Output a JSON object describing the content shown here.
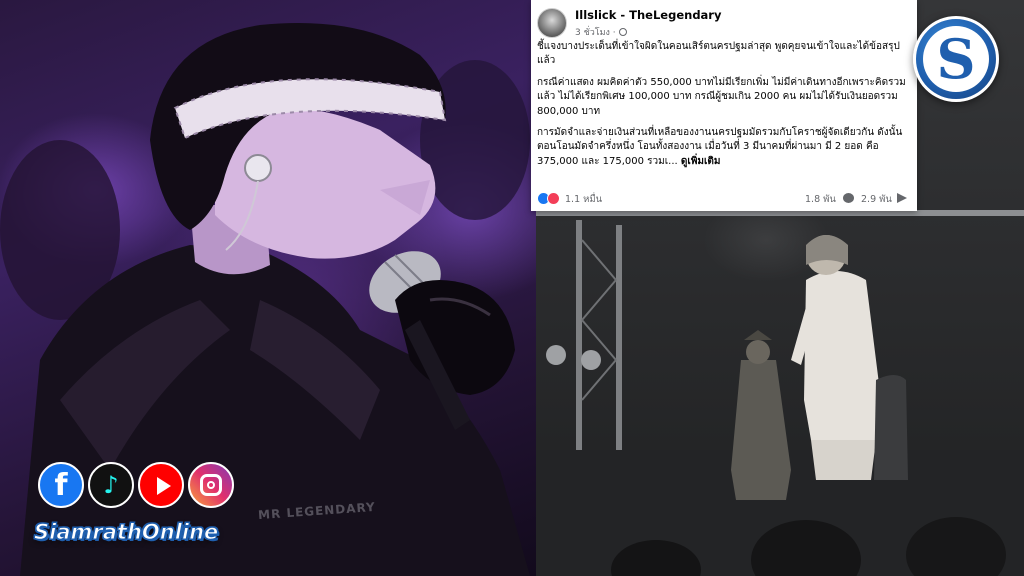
{
  "post": {
    "author": "Illslick - TheLegendary",
    "time": "3 ชั่วโมง ·",
    "paragraph_1": "ชี้แจงบางประเด็นที่เข้าใจผิดในคอนเสิร์ตนครปฐมล่าสุด พูดคุยจนเข้าใจและได้ข้อสรุปแล้ว",
    "paragraph_2": "กรณีค่าแสดง ผมคิดค่าตัว 550,000 บาทไม่มีเรียกเพิ่ม ไม่มีค่าเดินทางอีกเพราะคิดรวมแล้ว ไม่ได้เรียกพิเศษ 100,000 บาท กรณีผู้ชมเกิน 2000 คน ผมไม่ได้รับเงินยอดรวม 800,000 บาท",
    "paragraph_3": "การมัดจำและจ่ายเงินส่วนที่เหลือของงานนครปฐมมัดรวมกับโคราชผู้จัดเดียวกัน ดังนั้นตอนโอนมัดจำครึ่งหนึ่ง โอนทั้งสองงาน เมื่อวันที่ 3 มีนาคมที่ผ่านมา มี 2 ยอด คือ 375,000 และ 175,000 รวมเ...",
    "see_more": "ดูเพิ่มเติม",
    "reactions": "1.1 หมื่น",
    "comments": "1.8 พัน",
    "shares": "2.9 พัน"
  },
  "logo": {
    "letter": "S"
  },
  "social_icons": [
    "facebook-icon",
    "tiktok-icon",
    "youtube-icon",
    "instagram-icon"
  ],
  "brand": "SiamrathOnline",
  "watermark": "MR LEGENDARY",
  "colors": {
    "brand_blue": "#1f5fae",
    "facebook_blue": "#1877f2",
    "love_red": "#f33e58"
  }
}
